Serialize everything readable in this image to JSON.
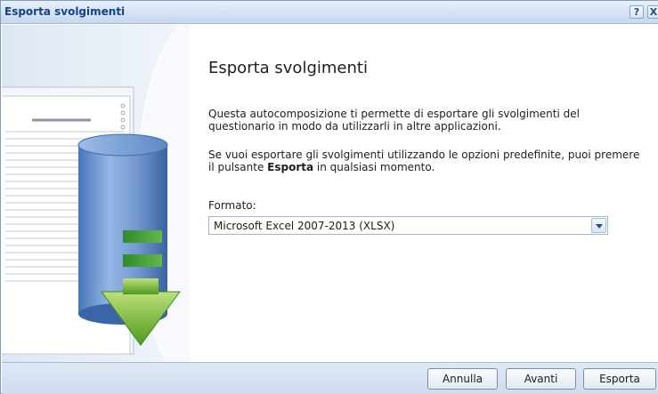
{
  "window": {
    "title": "Esporta svolgimenti",
    "help_label": "?",
    "close_label": "X"
  },
  "content": {
    "heading": "Esporta svolgimenti",
    "paragraph1": "Questa autocomposizione ti permette di esportare gli svolgimenti del questionario in modo da utilizzarli in altre applicazioni.",
    "paragraph2_before": "Se vuoi esportare gli svolgimenti utilizzando le opzioni predefinite, puoi premere il pulsante ",
    "paragraph2_bold": "Esporta",
    "paragraph2_after": " in qualsiasi momento.",
    "format_label": "Formato:",
    "format_selected": "Microsoft Excel 2007-2013 (XLSX)"
  },
  "buttons": {
    "cancel": "Annulla",
    "next": "Avanti",
    "export": "Esporta"
  },
  "icons": {
    "illustration": "database-export-icon"
  }
}
